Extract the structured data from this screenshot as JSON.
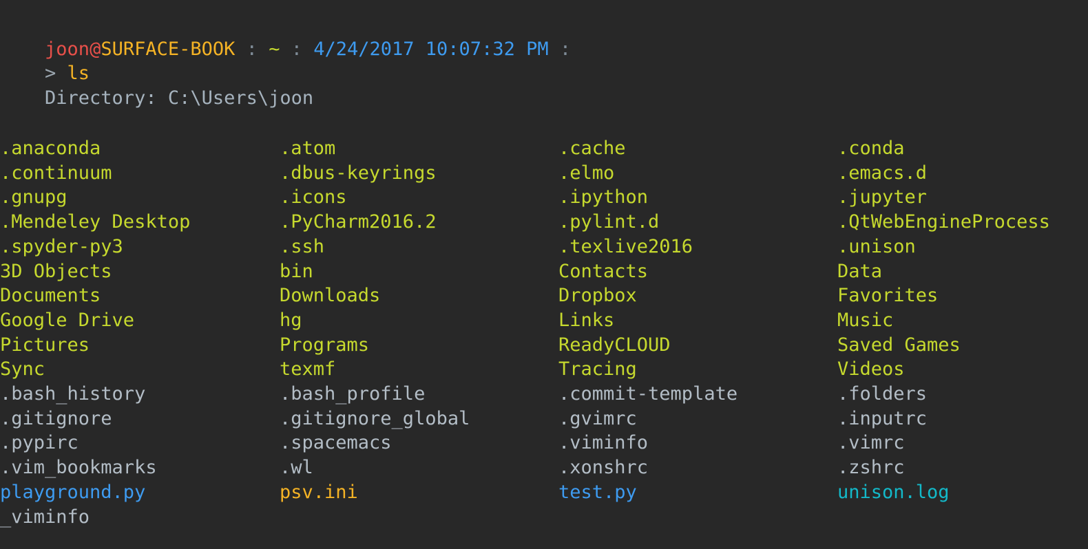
{
  "terminal": {
    "background_color": "#282828",
    "prompt": {
      "user": "joon",
      "at": "@",
      "host": "SURFACE-BOOK",
      "sep1": " : ",
      "path_short": "~",
      "sep2": " : ",
      "datetime": "4/24/2017 10:07:32 PM",
      "sep3": " :",
      "colors": {
        "user": "#E8504A",
        "host": "#F5B325",
        "separator": "#7E8B96",
        "tilde": "#C6D92E",
        "datetime": "#3E9BF0"
      }
    },
    "command_line": {
      "arrow": "> ",
      "command": "ls",
      "colors": {
        "arrow": "#9AA5AE",
        "command": "#F5B325"
      }
    },
    "directory_header": "    Directory: C:\\Users\\joon",
    "listing_colors": {
      "directory": "#C6D92E",
      "file": "#B3BDC6",
      "python": "#3E9BF0",
      "ini": "#F5B325",
      "log": "#13B9C9"
    },
    "listing_rows": [
      [
        {
          "text": ".anaconda",
          "kind": "directory"
        },
        {
          "text": ".atom",
          "kind": "directory"
        },
        {
          "text": ".cache",
          "kind": "directory"
        },
        {
          "text": ".conda",
          "kind": "directory"
        }
      ],
      [
        {
          "text": ".continuum",
          "kind": "directory"
        },
        {
          "text": ".dbus-keyrings",
          "kind": "directory"
        },
        {
          "text": ".elmo",
          "kind": "directory"
        },
        {
          "text": ".emacs.d",
          "kind": "directory"
        }
      ],
      [
        {
          "text": ".gnupg",
          "kind": "directory"
        },
        {
          "text": ".icons",
          "kind": "directory"
        },
        {
          "text": ".ipython",
          "kind": "directory"
        },
        {
          "text": ".jupyter",
          "kind": "directory"
        }
      ],
      [
        {
          "text": ".Mendeley Desktop",
          "kind": "directory"
        },
        {
          "text": ".PyCharm2016.2",
          "kind": "directory"
        },
        {
          "text": ".pylint.d",
          "kind": "directory"
        },
        {
          "text": ".QtWebEngineProcess",
          "kind": "directory"
        }
      ],
      [
        {
          "text": ".spyder-py3",
          "kind": "directory"
        },
        {
          "text": ".ssh",
          "kind": "directory"
        },
        {
          "text": ".texlive2016",
          "kind": "directory"
        },
        {
          "text": ".unison",
          "kind": "directory"
        }
      ],
      [
        {
          "text": "3D Objects",
          "kind": "directory"
        },
        {
          "text": "bin",
          "kind": "directory"
        },
        {
          "text": "Contacts",
          "kind": "directory"
        },
        {
          "text": "Data",
          "kind": "directory"
        }
      ],
      [
        {
          "text": "Documents",
          "kind": "directory"
        },
        {
          "text": "Downloads",
          "kind": "directory"
        },
        {
          "text": "Dropbox",
          "kind": "directory"
        },
        {
          "text": "Favorites",
          "kind": "directory"
        }
      ],
      [
        {
          "text": "Google Drive",
          "kind": "directory"
        },
        {
          "text": "hg",
          "kind": "directory"
        },
        {
          "text": "Links",
          "kind": "directory"
        },
        {
          "text": "Music",
          "kind": "directory"
        }
      ],
      [
        {
          "text": "Pictures",
          "kind": "directory"
        },
        {
          "text": "Programs",
          "kind": "directory"
        },
        {
          "text": "ReadyCLOUD",
          "kind": "directory"
        },
        {
          "text": "Saved Games",
          "kind": "directory"
        }
      ],
      [
        {
          "text": "Sync",
          "kind": "directory"
        },
        {
          "text": "texmf",
          "kind": "directory"
        },
        {
          "text": "Tracing",
          "kind": "directory"
        },
        {
          "text": "Videos",
          "kind": "directory"
        }
      ],
      [
        {
          "text": ".bash_history",
          "kind": "file"
        },
        {
          "text": ".bash_profile",
          "kind": "file"
        },
        {
          "text": ".commit-template",
          "kind": "file"
        },
        {
          "text": ".folders",
          "kind": "file"
        }
      ],
      [
        {
          "text": ".gitignore",
          "kind": "file"
        },
        {
          "text": ".gitignore_global",
          "kind": "file"
        },
        {
          "text": ".gvimrc",
          "kind": "file"
        },
        {
          "text": ".inputrc",
          "kind": "file"
        }
      ],
      [
        {
          "text": ".pypirc",
          "kind": "file"
        },
        {
          "text": ".spacemacs",
          "kind": "file"
        },
        {
          "text": ".viminfo",
          "kind": "file"
        },
        {
          "text": ".vimrc",
          "kind": "file"
        }
      ],
      [
        {
          "text": ".vim_bookmarks",
          "kind": "file"
        },
        {
          "text": ".wl",
          "kind": "file"
        },
        {
          "text": ".xonshrc",
          "kind": "file"
        },
        {
          "text": ".zshrc",
          "kind": "file"
        }
      ],
      [
        {
          "text": "playground.py",
          "kind": "python"
        },
        {
          "text": "psv.ini",
          "kind": "ini"
        },
        {
          "text": "test.py",
          "kind": "python"
        },
        {
          "text": "unison.log",
          "kind": "log"
        }
      ],
      [
        {
          "text": "_viminfo",
          "kind": "file"
        },
        {
          "text": "",
          "kind": "file"
        },
        {
          "text": "",
          "kind": "file"
        },
        {
          "text": "",
          "kind": "file"
        }
      ]
    ]
  }
}
